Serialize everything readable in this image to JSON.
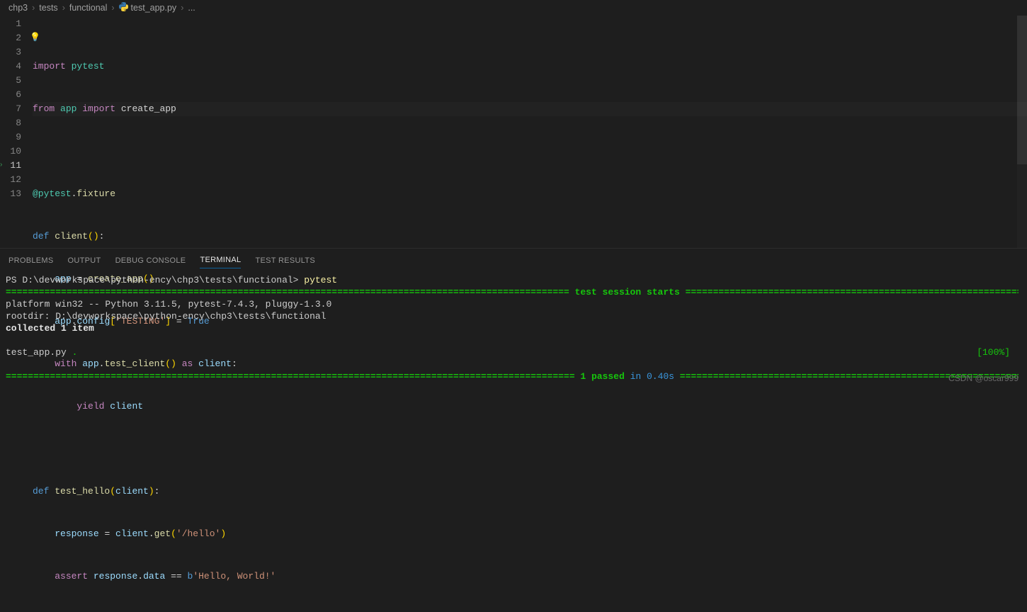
{
  "breadcrumbs": {
    "seg1": "chp3",
    "seg2": "tests",
    "seg3": "functional",
    "seg4": "test_app.py",
    "seg5": "...",
    "sep": "›"
  },
  "lines": {
    "n1": "1",
    "n2": "2",
    "n3": "3",
    "n4": "4",
    "n5": "5",
    "n6": "6",
    "n7": "7",
    "n8": "8",
    "n9": "9",
    "n10": "10",
    "n11": "11",
    "n12": "12",
    "n13": "13"
  },
  "code": {
    "l1": {
      "t1": "import",
      "t2": " pytest"
    },
    "l2": {
      "t1": "from",
      "t2": " app ",
      "t3": "import",
      "t4": " create_app"
    },
    "l4": {
      "t1": "@pytest",
      "t2": ".",
      "t3": "fixture"
    },
    "l5": {
      "t1": "def",
      "t2": " ",
      "t3": "client",
      "t4": "()",
      "t5": ":"
    },
    "l6": {
      "t1": "    ",
      "t2": "app",
      "t3": " = ",
      "t4": "create_app",
      "t5": "()"
    },
    "l7": {
      "t1": "    ",
      "t2": "app",
      "t3": ".",
      "t4": "config",
      "t5": "[",
      "t6": "'TESTING'",
      "t7": "]",
      "t8": " = ",
      "t9": "True"
    },
    "l8": {
      "t1": "    ",
      "t2": "with",
      "t3": " ",
      "t4": "app",
      "t5": ".",
      "t6": "test_client",
      "t7": "()",
      "t8": " ",
      "t9": "as",
      "t10": " ",
      "t11": "client",
      "t12": ":"
    },
    "l9": {
      "t1": "        ",
      "t2": "yield",
      "t3": " ",
      "t4": "client"
    },
    "l11": {
      "t1": "def",
      "t2": " ",
      "t3": "test_hello",
      "t4": "(",
      "t5": "client",
      "t6": ")",
      "t7": ":"
    },
    "l12": {
      "t1": "    ",
      "t2": "response",
      "t3": " = ",
      "t4": "client",
      "t5": ".",
      "t6": "get",
      "t7": "(",
      "t8": "'/hello'",
      "t9": ")"
    },
    "l13": {
      "t1": "    ",
      "t2": "assert",
      "t3": " ",
      "t4": "response",
      "t5": ".",
      "t6": "data",
      "t7": " == ",
      "t8": "b",
      "t9": "'Hello, World!'"
    }
  },
  "panel": {
    "tabs": {
      "problems": "PROBLEMS",
      "output": "OUTPUT",
      "debug": "DEBUG CONSOLE",
      "terminal": "TERMINAL",
      "tests": "TEST RESULTS"
    }
  },
  "terminal": {
    "prompt": "PS D:\\devworkspace\\python-ency\\chp3\\tests\\functional> ",
    "command": "pytest",
    "sepEqL": "====================================================================================================== ",
    "sessionStarts": "test session starts",
    "sepEqR": " =======================================================================================================",
    "platform": "platform win32 -- Python 3.11.5, pytest-7.4.3, pluggy-1.3.0",
    "rootdir": "rootdir: D:\\devworkspace\\python-ency\\chp3\\tests\\functional",
    "collected": "collected 1 item",
    "testfile": "test_app.py ",
    "dot": ".",
    "percent": "[100%]",
    "sepEq2L": "======================================================================================================= ",
    "passed": "1 passed",
    "inTime": " in 0.40s",
    "sepEq2R": " ======================================================================================================="
  },
  "watermark": "CSDN @oscar999",
  "icons": {
    "bulb": "💡",
    "chevMark": "›"
  }
}
